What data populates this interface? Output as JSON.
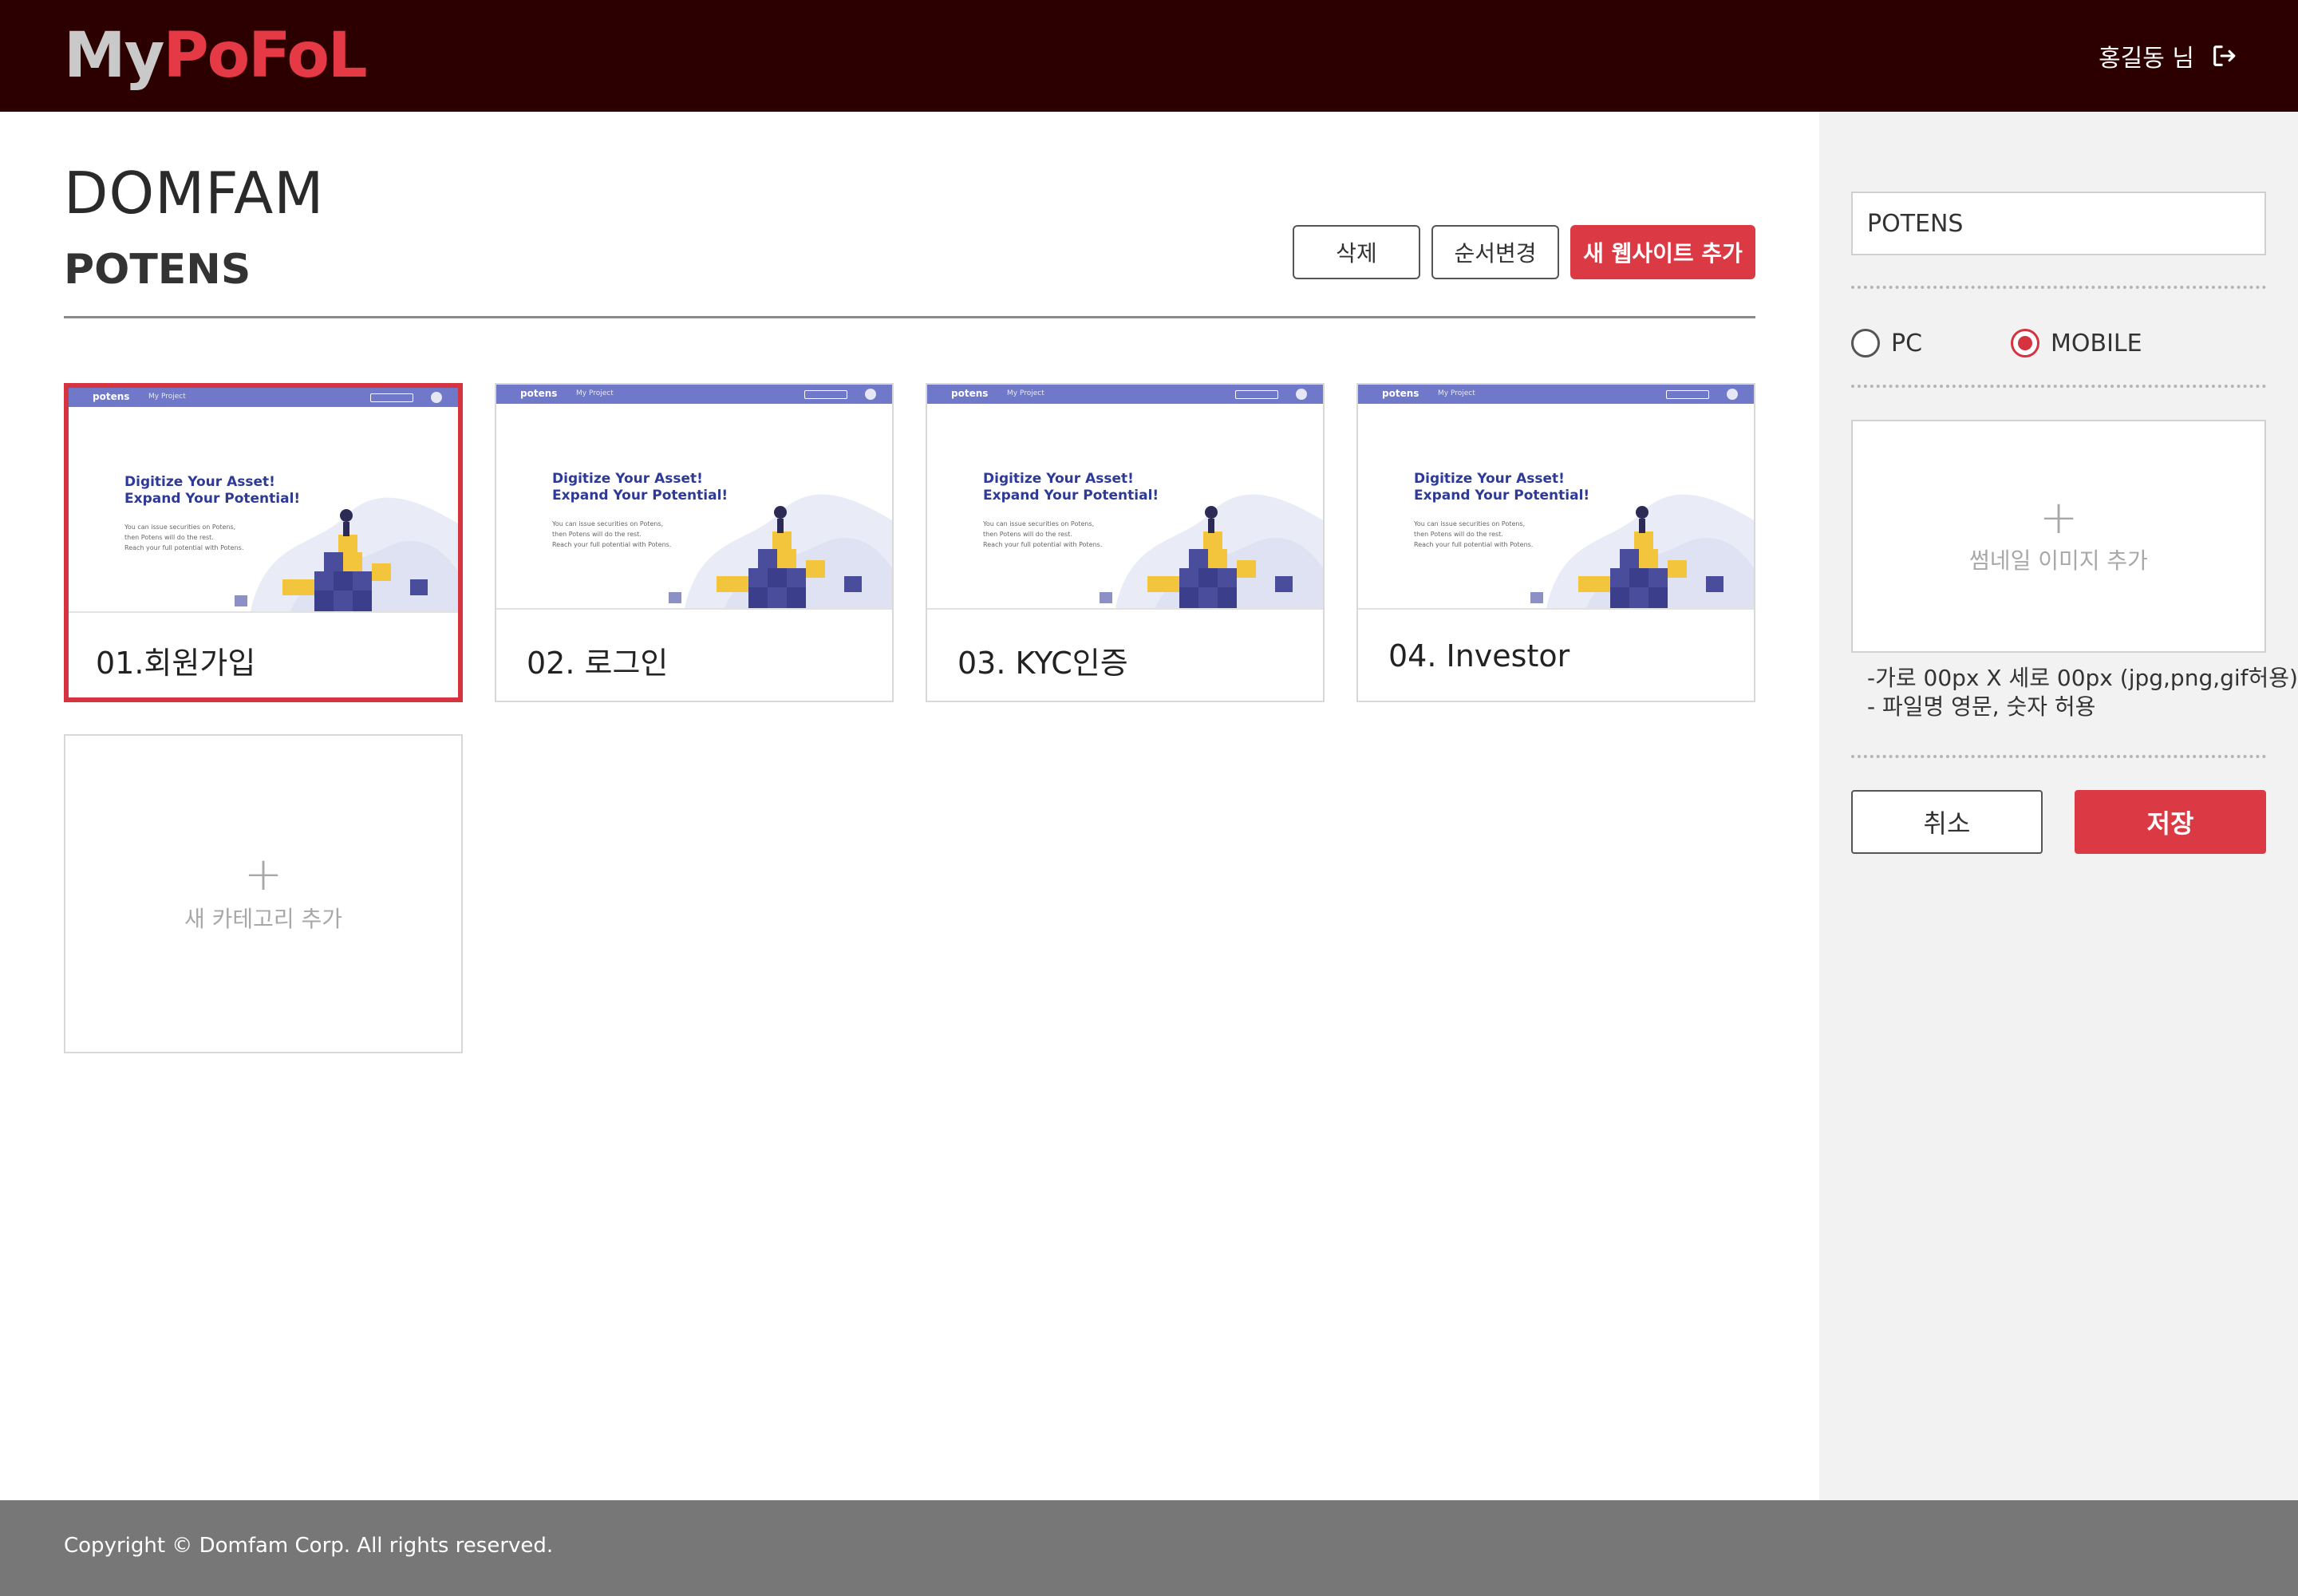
{
  "header": {
    "logo_my": "My",
    "logo_pofol": "PoFoL",
    "user_name": "홍길동 님",
    "logout_icon": "logout-icon"
  },
  "main": {
    "title": "DOMFAM",
    "subtitle": "POTENS",
    "actions": {
      "delete_label": "삭제",
      "reorder_label": "순서변경",
      "add_site_label": "새 웹사이트 추가"
    },
    "thumbnail": {
      "brand": "potens",
      "nav": "My Project",
      "headline_line1": "Digitize Your Asset!",
      "headline_line2": "Expand Your Potential!",
      "body_line1": "You can issue securities on Potens,",
      "body_line2": "then Potens will do the rest.",
      "body_line3": "Reach your full potential with Potens."
    },
    "cards": [
      {
        "label": "01.회원가입",
        "selected": true
      },
      {
        "label": "02. 로그인",
        "selected": false
      },
      {
        "label": "03. KYC인증",
        "selected": false
      },
      {
        "label": "04. Investor",
        "selected": false
      }
    ],
    "add_category": {
      "plus": "+",
      "label": "새 카테고리 추가"
    }
  },
  "sidebar": {
    "name_value": "POTENS",
    "radio_pc": "PC",
    "radio_mobile": "MOBILE",
    "selected_view": "MOBILE",
    "upload_plus": "+",
    "upload_label": "썸네일 이미지 추가",
    "hint_line1": "-가로 00px X 세로 00px (jpg,png,gif허용)",
    "hint_line2": "- 파일명 영문, 숫자 허용",
    "cancel_label": "취소",
    "save_label": "저장"
  },
  "footer": {
    "copyright": "Copyright © Domfam Corp. All rights reserved."
  },
  "colors": {
    "header_bg": "#2d0000",
    "accent": "#db3a45",
    "footer_bg": "#777777",
    "sidebar_bg": "#f2f2f2",
    "thumb_bar": "#6f78c9"
  }
}
